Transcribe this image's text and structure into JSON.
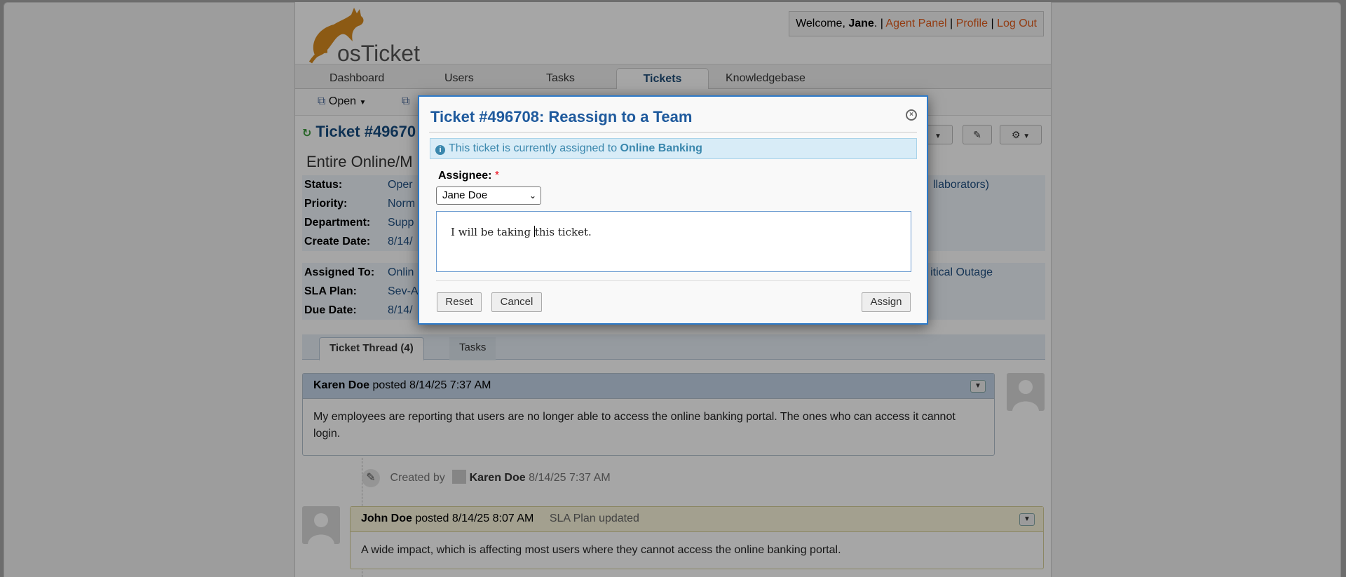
{
  "header": {
    "logo_text": "osTicket",
    "welcome_prefix": "Welcome, ",
    "welcome_name": "Jane",
    "welcome_suffix": ". | ",
    "agent_panel": "Agent Panel",
    "sep1": " | ",
    "profile": "Profile",
    "sep2": " | ",
    "logout": "Log Out"
  },
  "nav": {
    "tabs": [
      {
        "label": "Dashboard"
      },
      {
        "label": "Users"
      },
      {
        "label": "Tasks"
      },
      {
        "label": "Tickets"
      },
      {
        "label": "Knowledgebase"
      }
    ],
    "active": "Tickets"
  },
  "subnav": {
    "open_label": "Open"
  },
  "ticket": {
    "title_visible": "Ticket #49670",
    "subject_visible": "Entire Online/M",
    "fields_left": [
      {
        "label": "Status:",
        "value": "Oper"
      },
      {
        "label": "Priority:",
        "value": "Norm"
      },
      {
        "label": "Department:",
        "value": "Supp"
      },
      {
        "label": "Create Date:",
        "value": "8/14/"
      }
    ],
    "right_value_1": "llaborators)",
    "fields_left2": [
      {
        "label": "Assigned To:",
        "value": "Onlin"
      },
      {
        "label": "SLA Plan:",
        "value": "Sev-A"
      },
      {
        "label": "Due Date:",
        "value": "8/14/"
      }
    ],
    "right_value_2": "itical Outage"
  },
  "thread_tabs": {
    "thread": "Ticket Thread (4)",
    "tasks": "Tasks"
  },
  "thread": {
    "entry1": {
      "author": "Karen Doe",
      "posted": " posted 8/14/25 7:37 AM",
      "body": "My employees are reporting that users are no longer able to access the online banking portal. The ones who can access it cannot login."
    },
    "event": {
      "prefix": "Created by",
      "name": "Karen Doe",
      "time": "8/14/25 7:37 AM"
    },
    "entry2": {
      "author": "John Doe",
      "posted": " posted 8/14/25 8:07 AM",
      "note": "SLA Plan updated",
      "body": "A wide impact, which is affecting most users where they cannot access the online banking portal."
    }
  },
  "modal": {
    "title": "Ticket #496708: Reassign to a Team",
    "notice_prefix": "This ticket is currently assigned to ",
    "notice_team": "Online Banking",
    "assignee_label": "Assignee:",
    "required_mark": "*",
    "assignee_value": "Jane Doe",
    "comment_before_cursor": "I will be taking ",
    "comment_after_cursor": "this ticket.",
    "reset": "Reset",
    "cancel": "Cancel",
    "assign": "Assign"
  },
  "colors": {
    "link_orange": "#e25d1d",
    "title_blue": "#1f5a9d",
    "notice_bg": "#d8ecf7"
  }
}
